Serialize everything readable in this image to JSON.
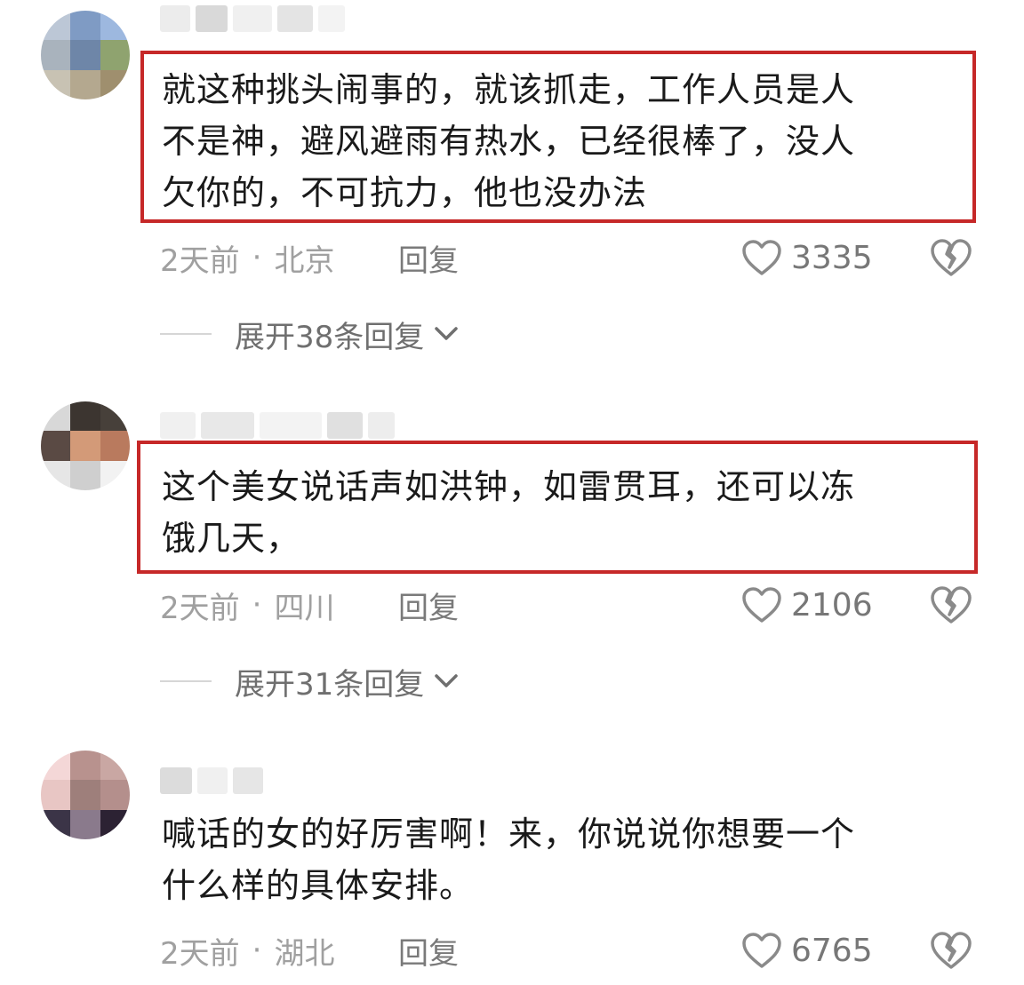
{
  "comments": [
    {
      "text_lines": [
        "就这种挑头闹事的，就该抓走，工作人员是人",
        "不是神，避风避雨有热水，已经很棒了，没人",
        "欠你的，不可抗力，他也没办法"
      ],
      "time": "2天前",
      "separator": "·",
      "location": "北京",
      "reply_label": "回复",
      "likes": "3335",
      "expand_label": "展开38条回复"
    },
    {
      "text_lines": [
        "这个美女说话声如洪钟，如雷贯耳，还可以冻",
        "饿几天，"
      ],
      "time": "2天前",
      "separator": "·",
      "location": "四川",
      "reply_label": "回复",
      "likes": "2106",
      "expand_label": "展开31条回复"
    },
    {
      "text_lines": [
        "喊话的女的好厉害啊！来，你说说你想要一个",
        "什么样的具体安排。"
      ],
      "time": "2天前",
      "separator": "·",
      "location": "湖北",
      "reply_label": "回复",
      "likes": "6765"
    }
  ],
  "icons": {
    "like": "heart-outline-icon",
    "dislike": "broken-heart-icon",
    "expand": "chevron-down-icon"
  },
  "colors": {
    "highlight_border": "#c62828",
    "meta_text": "#a0a0a0",
    "body_text": "#1a1a1a"
  }
}
